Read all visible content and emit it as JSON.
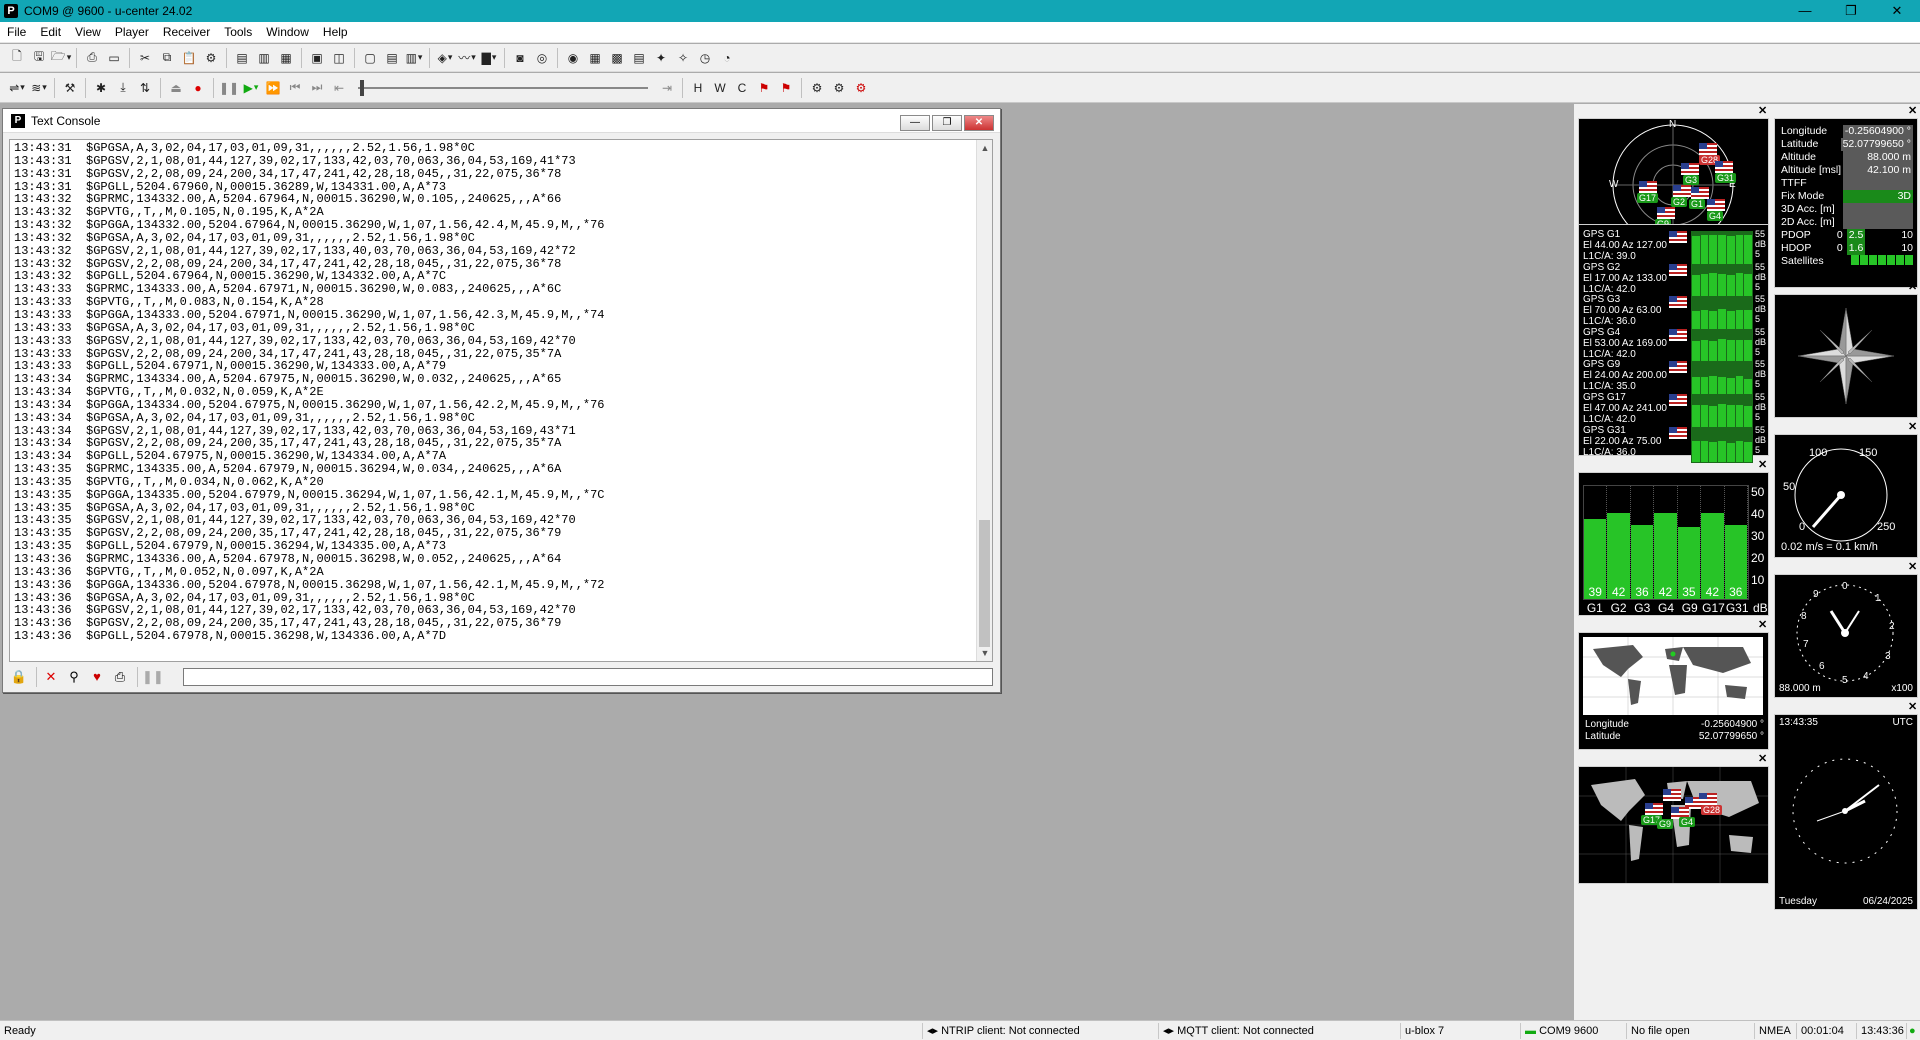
{
  "window": {
    "title": "COM9 @ 9600 - u-center 24.02",
    "app_icon": "P"
  },
  "menu": [
    "File",
    "Edit",
    "View",
    "Player",
    "Receiver",
    "Tools",
    "Window",
    "Help"
  ],
  "console": {
    "title": "Text Console",
    "lines": [
      "13:43:31  $GPGSA,A,3,02,04,17,03,01,09,31,,,,,,2.52,1.56,1.98*0C",
      "13:43:31  $GPGSV,2,1,08,01,44,127,39,02,17,133,42,03,70,063,36,04,53,169,41*73",
      "13:43:31  $GPGSV,2,2,08,09,24,200,34,17,47,241,42,28,18,045,,31,22,075,36*78",
      "13:43:31  $GPGLL,5204.67960,N,00015.36289,W,134331.00,A,A*73",
      "13:43:32  $GPRMC,134332.00,A,5204.67964,N,00015.36290,W,0.105,,240625,,,A*66",
      "13:43:32  $GPVTG,,T,,M,0.105,N,0.195,K,A*2A",
      "13:43:32  $GPGGA,134332.00,5204.67964,N,00015.36290,W,1,07,1.56,42.4,M,45.9,M,,*76",
      "13:43:32  $GPGSA,A,3,02,04,17,03,01,09,31,,,,,,2.52,1.56,1.98*0C",
      "13:43:32  $GPGSV,2,1,08,01,44,127,39,02,17,133,40,03,70,063,36,04,53,169,42*72",
      "13:43:32  $GPGSV,2,2,08,09,24,200,34,17,47,241,42,28,18,045,,31,22,075,36*78",
      "13:43:32  $GPGLL,5204.67964,N,00015.36290,W,134332.00,A,A*7C",
      "13:43:33  $GPRMC,134333.00,A,5204.67971,N,00015.36290,W,0.083,,240625,,,A*6C",
      "13:43:33  $GPVTG,,T,,M,0.083,N,0.154,K,A*28",
      "13:43:33  $GPGGA,134333.00,5204.67971,N,00015.36290,W,1,07,1.56,42.3,M,45.9,M,,*74",
      "13:43:33  $GPGSA,A,3,02,04,17,03,01,09,31,,,,,,2.52,1.56,1.98*0C",
      "13:43:33  $GPGSV,2,1,08,01,44,127,39,02,17,133,42,03,70,063,36,04,53,169,42*70",
      "13:43:33  $GPGSV,2,2,08,09,24,200,34,17,47,241,43,28,18,045,,31,22,075,35*7A",
      "13:43:33  $GPGLL,5204.67971,N,00015.36290,W,134333.00,A,A*79",
      "13:43:34  $GPRMC,134334.00,A,5204.67975,N,00015.36290,W,0.032,,240625,,,A*65",
      "13:43:34  $GPVTG,,T,,M,0.032,N,0.059,K,A*2E",
      "13:43:34  $GPGGA,134334.00,5204.67975,N,00015.36290,W,1,07,1.56,42.2,M,45.9,M,,*76",
      "13:43:34  $GPGSA,A,3,02,04,17,03,01,09,31,,,,,,2.52,1.56,1.98*0C",
      "13:43:34  $GPGSV,2,1,08,01,44,127,39,02,17,133,42,03,70,063,36,04,53,169,43*71",
      "13:43:34  $GPGSV,2,2,08,09,24,200,35,17,47,241,43,28,18,045,,31,22,075,35*7A",
      "13:43:34  $GPGLL,5204.67975,N,00015.36290,W,134334.00,A,A*7A",
      "13:43:35  $GPRMC,134335.00,A,5204.67979,N,00015.36294,W,0.034,,240625,,,A*6A",
      "13:43:35  $GPVTG,,T,,M,0.034,N,0.062,K,A*20",
      "13:43:35  $GPGGA,134335.00,5204.67979,N,00015.36294,W,1,07,1.56,42.1,M,45.9,M,,*7C",
      "13:43:35  $GPGSA,A,3,02,04,17,03,01,09,31,,,,,,2.52,1.56,1.98*0C",
      "13:43:35  $GPGSV,2,1,08,01,44,127,39,02,17,133,42,03,70,063,36,04,53,169,42*70",
      "13:43:35  $GPGSV,2,2,08,09,24,200,35,17,47,241,42,28,18,045,,31,22,075,36*79",
      "13:43:35  $GPGLL,5204.67979,N,00015.36294,W,134335.00,A,A*73",
      "13:43:36  $GPRMC,134336.00,A,5204.67978,N,00015.36298,W,0.052,,240625,,,A*64",
      "13:43:36  $GPVTG,,T,,M,0.052,N,0.097,K,A*2A",
      "13:43:36  $GPGGA,134336.00,5204.67978,N,00015.36298,W,1,07,1.56,42.1,M,45.9,M,,*72",
      "13:43:36  $GPGSA,A,3,02,04,17,03,01,09,31,,,,,,2.52,1.56,1.98*0C",
      "13:43:36  $GPGSV,2,1,08,01,44,127,39,02,17,133,42,03,70,063,36,04,53,169,42*70",
      "13:43:36  $GPGSV,2,2,08,09,24,200,35,17,47,241,43,28,18,045,,31,22,075,36*79",
      "13:43:36  $GPGLL,5204.67978,N,00015.36298,W,134336.00,A,A*7D"
    ]
  },
  "sky": {
    "n": "N",
    "s": "S",
    "e": "E",
    "w": "W",
    "sats": [
      "G1",
      "G2",
      "G3",
      "G4",
      "G9",
      "G17",
      "G31",
      "G28"
    ]
  },
  "gps_list": [
    {
      "name": "GPS G1",
      "elaz": "El 44.00 Az 127.00",
      "l1": "L1C/A: 39.0"
    },
    {
      "name": "GPS G2",
      "elaz": "El 17.00 Az 133.00",
      "l1": "L1C/A: 42.0"
    },
    {
      "name": "GPS G3",
      "elaz": "El 70.00 Az 63.00",
      "l1": "L1C/A: 36.0"
    },
    {
      "name": "GPS G4",
      "elaz": "El 53.00 Az 169.00",
      "l1": "L1C/A: 42.0"
    },
    {
      "name": "GPS G9",
      "elaz": "El 24.00 Az 200.00",
      "l1": "L1C/A: 35.0"
    },
    {
      "name": "GPS G17",
      "elaz": "El 47.00 Az 241.00",
      "l1": "L1C/A: 42.0"
    },
    {
      "name": "GPS G31",
      "elaz": "El 22.00 Az 75.00",
      "l1": "L1C/A: 36.0"
    }
  ],
  "scale_labels": [
    "55",
    "dB",
    "5"
  ],
  "signal": {
    "labels": [
      "G1",
      "G2",
      "G3",
      "G4",
      "G9",
      "G17",
      "G31"
    ],
    "values": [
      39,
      42,
      36,
      42,
      35,
      42,
      36
    ],
    "unit": "dB",
    "yticks": [
      "50",
      "40",
      "30",
      "20",
      "10"
    ]
  },
  "info": {
    "rows": [
      {
        "k": "Longitude",
        "v": "-0.25604900 °"
      },
      {
        "k": "Latitude",
        "v": "52.07799650 °"
      },
      {
        "k": "Altitude",
        "v": "88.000 m"
      },
      {
        "k": "Altitude [msl]",
        "v": "42.100 m"
      },
      {
        "k": "TTFF",
        "v": ""
      },
      {
        "k": "Fix Mode",
        "v": "3D"
      },
      {
        "k": "3D Acc. [m]",
        "v": ""
      },
      {
        "k": "2D Acc. [m]",
        "v": ""
      }
    ],
    "pdop": {
      "label": "PDOP",
      "min": "0",
      "val": "2.5",
      "max": "10"
    },
    "hdop": {
      "label": "HDOP",
      "min": "0",
      "val": "1.6",
      "max": "10"
    },
    "satellites": "Satellites"
  },
  "speedo": {
    "t100": "100",
    "t150": "150",
    "t50": "50",
    "t0": "0",
    "t250": "250",
    "readout": "0.02 m/s = 0.1 km/h"
  },
  "altimeter": {
    "nums": [
      "0",
      "1",
      "2",
      "3",
      "4",
      "5",
      "6",
      "7",
      "8",
      "9"
    ],
    "readout": "88.000 m",
    "unit": "x100"
  },
  "map": {
    "lon_label": "Longitude",
    "lon": "-0.25604900 °",
    "lat_label": "Latitude",
    "lat": "52.07799650 °"
  },
  "clock": {
    "time": "13:43:35",
    "tz": "UTC",
    "day": "Tuesday",
    "date": "06/24/2025"
  },
  "status": {
    "ready": "Ready",
    "ntrip": "NTRIP client: Not connected",
    "mqtt": "MQTT client: Not connected",
    "device": "u-blox 7",
    "port": "COM9 9600",
    "file": "No file open",
    "proto": "NMEA",
    "elapsed": "00:01:04",
    "time": "13:43:36"
  }
}
